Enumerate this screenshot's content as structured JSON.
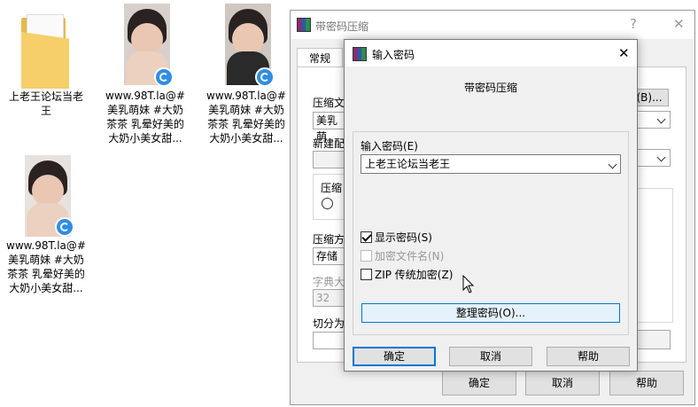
{
  "desktop": {
    "icons": [
      {
        "label": "上老王论坛当老王"
      },
      {
        "label": "www.98T.la@#美乳萌妹 #大奶茶茶 乳晕好美的大奶小美女甜..."
      },
      {
        "label": "www.98T.la@#美乳萌妹 #大奶茶茶 乳晕好美的大奶小美女甜..."
      },
      {
        "label": "www.98T.la@#美乳萌妹 #大奶茶茶 乳晕好美的大奶小美女甜..."
      }
    ]
  },
  "bg_dialog": {
    "title": "带密码压缩",
    "help_glyph": "?",
    "close_glyph": "✕",
    "tab": "常规",
    "labels": {
      "archive_name": "压缩文",
      "archive_value": "美乳萌",
      "profile": "新建配",
      "format": "压缩",
      "method": "压缩方",
      "method_value": "存储",
      "dict": "字典大",
      "dict_value": "32",
      "split": "切分为",
      "browse": "(B)..."
    },
    "buttons": {
      "ok": "确定",
      "cancel": "取消",
      "help": "帮助"
    }
  },
  "fg_dialog": {
    "title": "输入密码",
    "close_glyph": "✕",
    "heading": "带密码压缩",
    "password_label": "输入密码(E)",
    "password_value": "上老王论坛当老王",
    "show_password": {
      "label": "显示密码(S)",
      "checked": true
    },
    "encrypt_names": {
      "label": "加密文件名(N)",
      "checked": false,
      "disabled": true
    },
    "zip_legacy": {
      "label": "ZIP 传统加密(Z)",
      "checked": false
    },
    "organize_button": "整理密码(O)...",
    "buttons": {
      "ok": "确定",
      "cancel": "取消",
      "help": "帮助"
    }
  }
}
